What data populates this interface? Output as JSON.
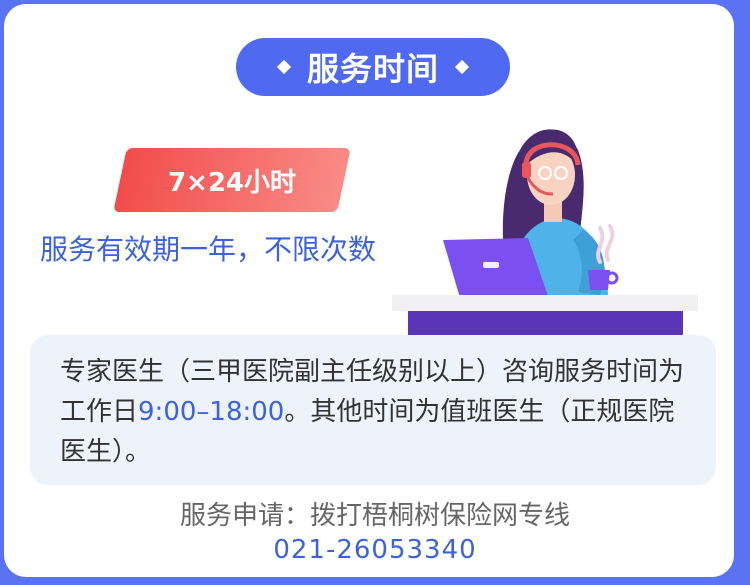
{
  "header": {
    "title": "服务时间"
  },
  "hours_tag": {
    "label": "7×24小时"
  },
  "validity": {
    "text": "服务有效期一年，不限次数"
  },
  "info": {
    "part1": "专家医生（三甲医院副主任级别以上）咨询服务时间为工作日",
    "hours": "9:00–18:00",
    "part2": "。其他时间为值班医生（正规医院医生）。"
  },
  "footer": {
    "label": "服务申请：拨打梧桐树保险网专线",
    "phone": "021-26053340"
  },
  "colors": {
    "accent": "#4f6af0",
    "highlight_text": "#3c63db",
    "tag_red": "#f24c4b",
    "info_bg": "#eef3fb"
  },
  "icons": {
    "title_ornament": "diamond",
    "illustration": "customer-service-agent-with-laptop-and-coffee"
  }
}
